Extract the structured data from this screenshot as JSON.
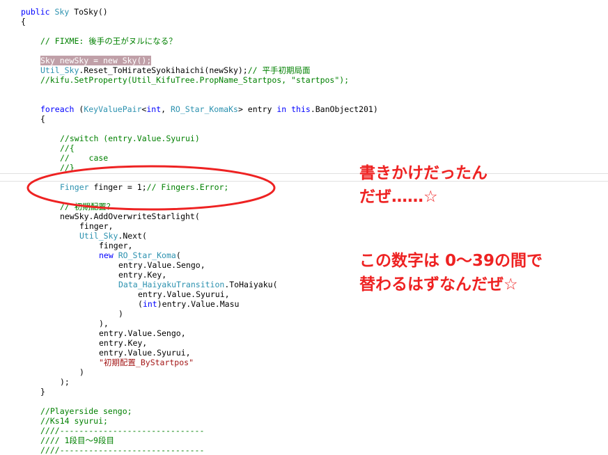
{
  "code": {
    "l01": [
      "public",
      "Sky",
      "ToSky()"
    ],
    "l02": "{",
    "l03": "// FIXME: 後手の王がヌルになる？",
    "l04": "Sky newSky = new Sky();",
    "l05": [
      "Util_Sky",
      ".Reset_ToHirateSyokihaichi(newSky);",
      "// 平手初期局面"
    ],
    "l06": "//kifu.SetProperty(Util_KifuTree.PropName_Startpos, \"startpos\");",
    "l07": [
      "foreach",
      " (",
      "KeyValuePair",
      "<",
      "int",
      ", ",
      "RO_Star_KomaKs",
      "> entry ",
      "in",
      " ",
      "this",
      ".BanObject201)"
    ],
    "l08": "{",
    "l09": "//switch (entry.Value.Syurui)",
    "l10": "//{",
    "l11": "//    case",
    "l12": "//}",
    "l13": [
      "Finger",
      " finger = 1;",
      "// Fingers.Error;"
    ],
    "l14": "// 初期配置？",
    "l15": "newSky.AddOverwriteStarlight(",
    "l16": "finger,",
    "l17": [
      "Util_Sky",
      ".Next("
    ],
    "l18": "finger,",
    "l19": [
      "new",
      "RO_Star_Koma",
      "("
    ],
    "l20": "entry.Value.Sengo,",
    "l21": "entry.Key,",
    "l22": [
      "Data_HaiyakuTransition",
      ".ToHaiyaku("
    ],
    "l23": "entry.Value.Syurui,",
    "l24": [
      "(",
      "int",
      ")entry.Value.Masu"
    ],
    "l25": ")",
    "l26": "),",
    "l27": "entry.Value.Sengo,",
    "l28": "entry.Key,",
    "l29": "entry.Value.Syurui,",
    "l30": "\"初期配置_ByStartpos\"",
    "l31": ")",
    "l32": ");",
    "l33": "}",
    "l34": "//Playerside sengo;",
    "l35": "//Ks14 syurui;",
    "l36": "////------------------------------",
    "l37": "//// 1段目～9段目",
    "l38": "////------------------------------"
  },
  "annotations": {
    "note1_line1": "書きかけだったん",
    "note1_line2": "だぜ……☆",
    "note2_line1": "この数字は 0～39の間で",
    "note2_line2": "替わるはずなんだぜ☆"
  },
  "colors": {
    "keyword": "#0000ff",
    "type": "#2b91af",
    "comment": "#008000",
    "string": "#a31515",
    "annotation": "#ee2222",
    "selection": "#c0a0a8"
  }
}
